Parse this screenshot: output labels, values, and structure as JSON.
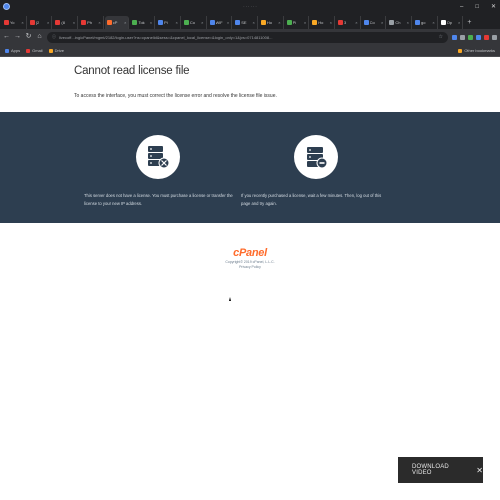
{
  "window": {
    "title": "· · ·  ·  · ·",
    "controls": [
      "–",
      "□",
      "✕"
    ]
  },
  "tabs": [
    {
      "label": "Yo",
      "color": "#e53935",
      "active": false
    },
    {
      "label": "(2",
      "color": "#e53935",
      "active": false
    },
    {
      "label": "(8",
      "color": "#e53935",
      "active": false
    },
    {
      "label": "Ph",
      "color": "#e53935",
      "active": false
    },
    {
      "label": "cP",
      "color": "#ff6c2c",
      "active": true
    },
    {
      "label": "Tok",
      "color": "#4caf50",
      "active": false
    },
    {
      "label": "Pi",
      "color": "#4f86ec",
      "active": false
    },
    {
      "label": "Co",
      "color": "#4caf50",
      "active": false
    },
    {
      "label": "WiF",
      "color": "#4f86ec",
      "active": false
    },
    {
      "label": "SE",
      "color": "#4f86ec",
      "active": false
    },
    {
      "label": "Ho",
      "color": "#f9a825",
      "active": false
    },
    {
      "label": "Pi",
      "color": "#4caf50",
      "active": false
    },
    {
      "label": "Ho",
      "color": "#f9a825",
      "active": false
    },
    {
      "label": "3",
      "color": "#e53935",
      "active": false
    },
    {
      "label": "Co",
      "color": "#4f86ec",
      "active": false
    },
    {
      "label": "Ch",
      "color": "#9aa0a6",
      "active": false
    },
    {
      "label": "go",
      "color": "#4f86ec",
      "active": false
    },
    {
      "label": "Op",
      "color": "#ffffff",
      "active": false
    }
  ],
  "newtab_label": "+",
  "toolbar": {
    "back": "←",
    "forward": "→",
    "reload": "↻",
    "home": "⌂",
    "lock": "ⓘ",
    "url": "livecoff...ing/cPanel/mgmt/2182/login-user?ns=cpanelid&sess=&cpanel_local_license=&login_only=1&jvs=0714811008...",
    "star": "☆",
    "ext_colors": [
      "#4f86ec",
      "#9aa0a6",
      "#4caf50",
      "#4f86ec",
      "#e53935",
      "#9aa0a6"
    ]
  },
  "bookmarks": {
    "items": [
      {
        "label": "Apps",
        "color": "#4f86ec"
      },
      {
        "label": "Gmail",
        "color": "#e53935"
      },
      {
        "label": "Drive",
        "color": "#f9a825"
      }
    ],
    "other": {
      "label": "Other bookmarks",
      "color": "#f9a825"
    }
  },
  "page": {
    "heading": "Cannot read license file",
    "intro": "To access the interface, you must correct the license error and resolve the license file issue.",
    "reasons": [
      "This server does not have a license. You must purchase a license or transfer the license to your new IP address.",
      "If you recently purchased a license, wait a few minutes. Then, log out of this page and try again."
    ],
    "logo_text": "cPanel",
    "copyright": "Copyright© 2019 cPanel, L.L.C.",
    "privacy": "Privacy Policy",
    "download_label": "DOWNLOAD VIDEO",
    "download_close": "✕"
  },
  "colors": {
    "band": "#2d3e50",
    "brand": "#ff6c2c"
  }
}
